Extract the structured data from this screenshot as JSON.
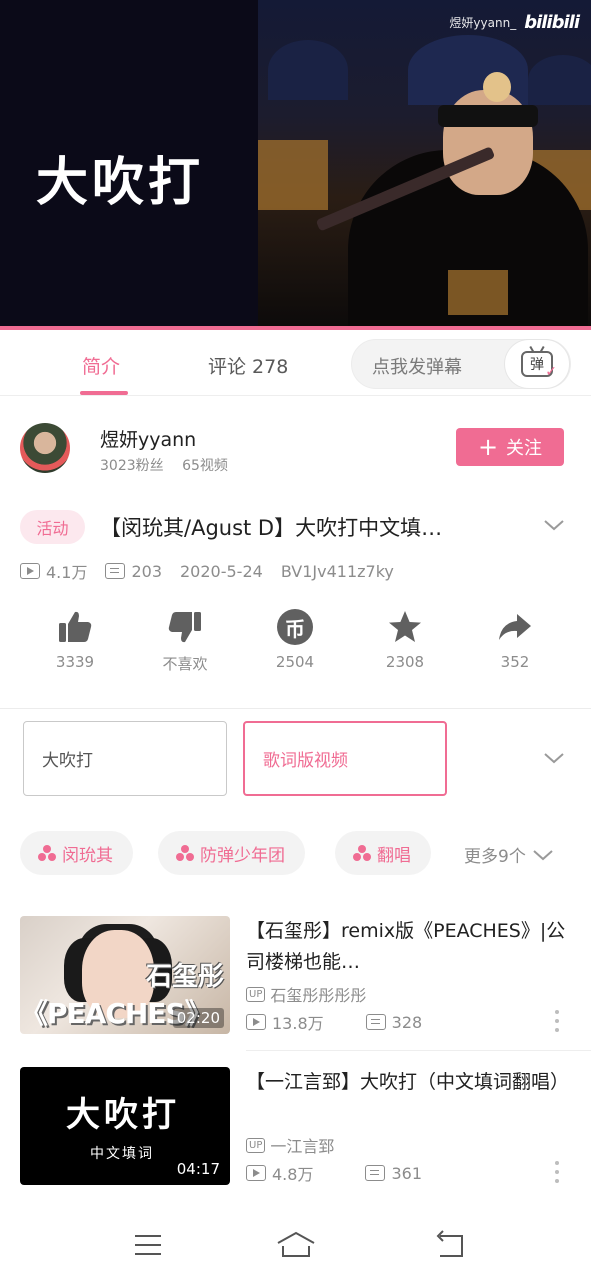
{
  "player": {
    "overlay_title": "大吹打",
    "watermark_user": "煜妍yyann_",
    "watermark_logo": "bilibili",
    "accent": "#f06c93"
  },
  "tabs": {
    "intro": "简介",
    "comments": "评论 278",
    "danmaku_placeholder": "点我发弹幕",
    "danmaku_icon_text": "弹"
  },
  "uploader": {
    "name": "煜妍yyann",
    "fans": "3023粉丝",
    "videos": "65视频",
    "follow_label": "关注"
  },
  "video": {
    "tag": "活动",
    "title": "【闵玧其/Agust D】大吹打中文填…",
    "views": "4.1万",
    "danmaku_count": "203",
    "date": "2020-5-24",
    "bvid": "BV1Jv411z7ky"
  },
  "actions": {
    "like": "3339",
    "dislike": "不喜欢",
    "coin": "2504",
    "coin_glyph": "币",
    "favorite": "2308",
    "share": "352"
  },
  "parts": [
    "大吹打",
    "歌词版视频"
  ],
  "tags": [
    "闵玧其",
    "防弹少年团",
    "翻唱"
  ],
  "more_tags": "更多9个",
  "recommended": [
    {
      "title": "【石玺彤】remix版《PEACHES》|公司楼梯也能…",
      "up": "石玺彤彤彤彤",
      "views": "13.8万",
      "danmaku": "328",
      "duration": "02:20",
      "thumb_name": "石玺彤",
      "thumb_text": "《PEACHES》"
    },
    {
      "title": "【一江言郅】大吹打（中文填词翻唱）",
      "up": "一江言郅",
      "views": "4.8万",
      "danmaku": "361",
      "duration": "04:17",
      "thumb_title": "大吹打",
      "thumb_sub": "中文填词"
    }
  ],
  "up_badge": "UP"
}
